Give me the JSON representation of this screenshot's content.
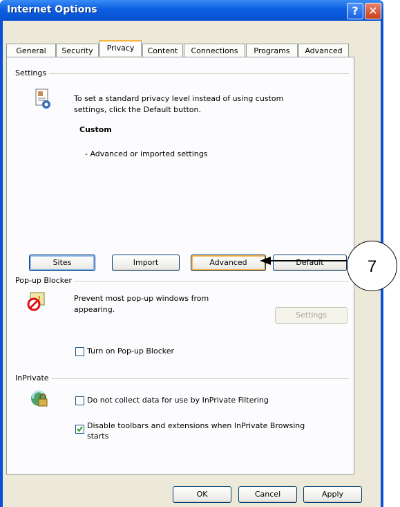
{
  "window": {
    "title": "Internet Options"
  },
  "tabs": [
    "General",
    "Security",
    "Privacy",
    "Content",
    "Connections",
    "Programs",
    "Advanced"
  ],
  "settings": {
    "group": "Settings",
    "desc": "To set a standard privacy level instead of using custom settings, click the Default button.",
    "desc1": "To set a standard privacy level instead of using custom",
    "desc2": "settings, click the Default button.",
    "level": "Custom",
    "detail": "- Advanced or imported settings",
    "buttons": {
      "sites": "Sites",
      "import": "Import",
      "advanced": "Advanced",
      "default": "Default"
    }
  },
  "popup": {
    "group": "Pop-up Blocker",
    "desc1": "Prevent most pop-up windows from",
    "desc2": "appearing.",
    "settings_button": "Settings",
    "checkbox": "Turn on Pop-up Blocker",
    "checked": false
  },
  "inprivate": {
    "group": "InPrivate",
    "checkbox1": "Do not collect data for use by InPrivate Filtering",
    "checkbox1_checked": false,
    "checkbox2_line1": "Disable toolbars and extensions when InPrivate Browsing",
    "checkbox2_line2": "starts",
    "checkbox2_checked": true
  },
  "footer": {
    "ok": "OK",
    "cancel": "Cancel",
    "apply": "Apply"
  },
  "annotation": {
    "number": "7"
  }
}
